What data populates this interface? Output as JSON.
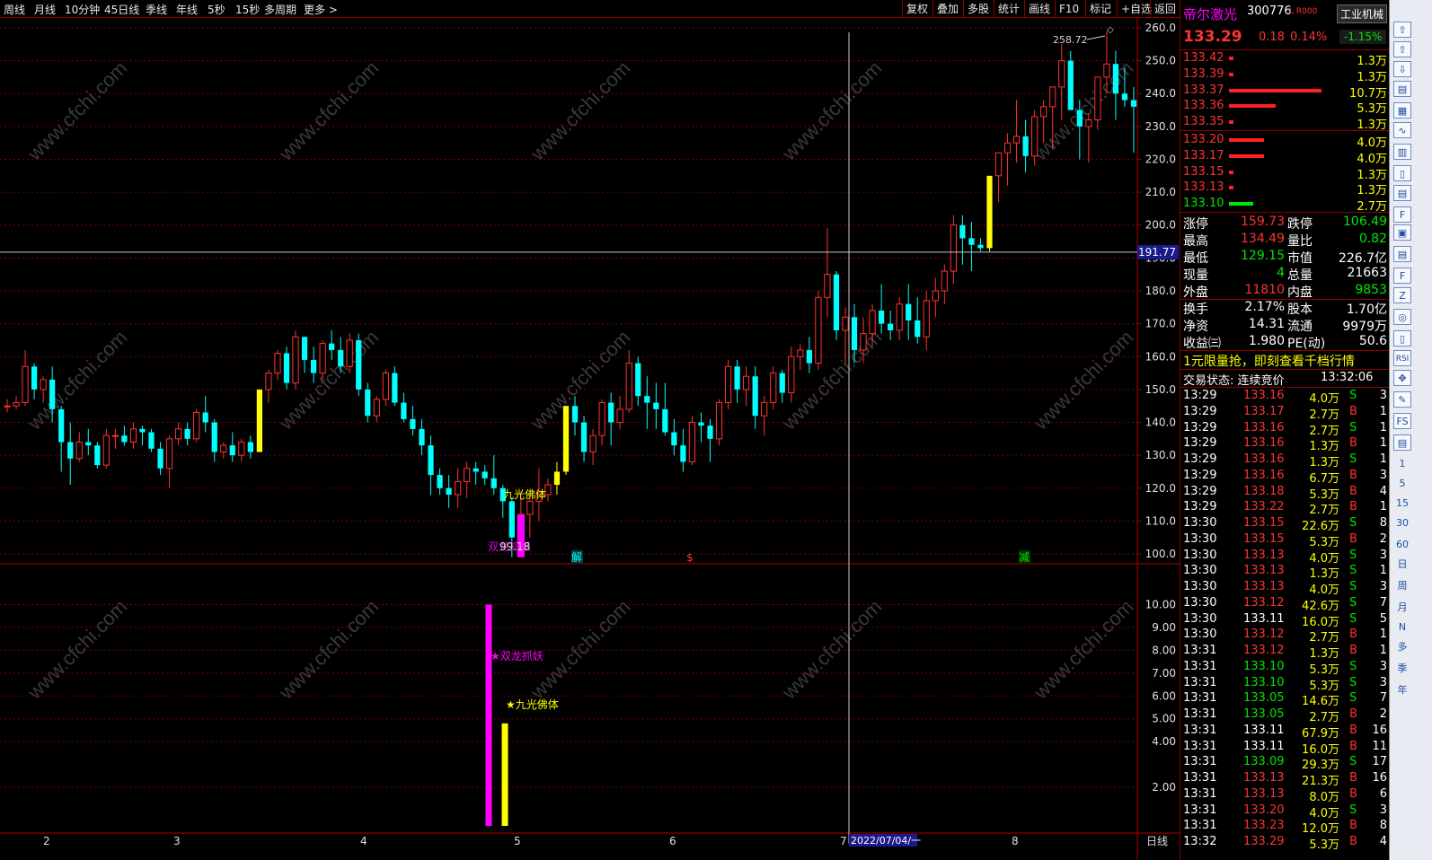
{
  "toolbar": {
    "left_items": [
      "周线",
      "月线",
      "10分钟",
      "45日线",
      "季线",
      "年线",
      "5秒",
      "15秒",
      "多周期",
      "更多 >"
    ],
    "right_items": [
      "复权",
      "叠加",
      "多股",
      "统计",
      "画线",
      "F10",
      "标记",
      "+自选",
      "返回"
    ]
  },
  "watermark": "www.cfchi.com",
  "main_chart": {
    "y_ticks": [
      "260.0",
      "250.0",
      "240.0",
      "230.0",
      "220.0",
      "210.0",
      "200.0",
      "190.0",
      "180.0",
      "170.0",
      "160.0",
      "150.0",
      "140.0",
      "130.0",
      "120.0",
      "110.0",
      "100.0"
    ],
    "y_range": [
      97,
      263
    ],
    "crosshair_price_label": "191.77",
    "crosshair_price": 191.77,
    "high_label": "258.72",
    "low_label": "99.18",
    "annotation_label": "九光佛体",
    "markers": [
      "解",
      "$",
      "减"
    ],
    "bottom_signal_label": "双龙抓妖"
  },
  "sub_chart": {
    "y_ticks": [
      "10.00",
      "9.00",
      "8.00",
      "7.00",
      "6.00",
      "5.00",
      "4.00",
      "2.00"
    ],
    "y_range": [
      0,
      11
    ],
    "bars": [
      {
        "label": "双龙抓妖",
        "value": 10,
        "color": "#ff00ff"
      },
      {
        "label": "九光佛体",
        "value": 4.8,
        "color": "#ffff00"
      }
    ]
  },
  "x_axis": {
    "labels": [
      "2",
      "3",
      "4",
      "5",
      "6",
      "7",
      "8"
    ],
    "date_label": "2022/07/04/一",
    "period_label": "日线"
  },
  "stock": {
    "name": "帝尔激光",
    "code": "300776",
    "flags": "L R000",
    "industry": "工业机械",
    "price": "133.29",
    "change": "0.18",
    "change_pct": "0.14%",
    "industry_pct": "-1.15%"
  },
  "order_book": {
    "asks": [
      {
        "price": "133.42",
        "vol": "1.3万",
        "bar": 0.05
      },
      {
        "price": "133.39",
        "vol": "1.3万",
        "bar": 0.05
      },
      {
        "price": "133.37",
        "vol": "10.7万",
        "bar": 0.95
      },
      {
        "price": "133.36",
        "vol": "5.3万",
        "bar": 0.48
      },
      {
        "price": "133.35",
        "vol": "1.3万",
        "bar": 0.05
      }
    ],
    "bids": [
      {
        "price": "133.20",
        "vol": "4.0万",
        "bar": 0.36
      },
      {
        "price": "133.17",
        "vol": "4.0万",
        "bar": 0.36
      },
      {
        "price": "133.15",
        "vol": "1.3万",
        "bar": 0.05
      },
      {
        "price": "133.13",
        "vol": "1.3万",
        "bar": 0.05
      },
      {
        "price": "133.10",
        "vol": "2.7万",
        "bar": 0.25
      }
    ]
  },
  "stats": [
    {
      "l1": "涨停",
      "v1": "159.73",
      "c1": "red",
      "l2": "跌停",
      "v2": "106.49",
      "c2": "green"
    },
    {
      "l1": "最高",
      "v1": "134.49",
      "c1": "red",
      "l2": "量比",
      "v2": "0.82",
      "c2": "green"
    },
    {
      "l1": "最低",
      "v1": "129.15",
      "c1": "green",
      "l2": "市值",
      "v2": "226.7亿",
      "c2": "white"
    },
    {
      "l1": "现量",
      "v1": "4",
      "c1": "green",
      "l2": "总量",
      "v2": "21663",
      "c2": "white"
    },
    {
      "l1": "外盘",
      "v1": "11810",
      "c1": "red",
      "l2": "内盘",
      "v2": "9853",
      "c2": "green"
    },
    {
      "l1": "换手",
      "v1": "2.17%",
      "c1": "white",
      "l2": "股本",
      "v2": "1.70亿",
      "c2": "white"
    },
    {
      "l1": "净资",
      "v1": "14.31",
      "c1": "white",
      "l2": "流通",
      "v2": "9979万",
      "c2": "white"
    },
    {
      "l1": "收益㈢",
      "v1": "1.980",
      "c1": "white",
      "l2": "PE(动)",
      "v2": "50.6",
      "c2": "white"
    }
  ],
  "promo": "1元限量抢，即刻查看千档行情",
  "trade_status": {
    "label": "交易状态: 连续竞价",
    "time": "13:32:06"
  },
  "ticks": [
    {
      "t": "13:29",
      "p": "133.16",
      "pc": "red",
      "v": "4.0万",
      "bs": "S",
      "n": "3"
    },
    {
      "t": "13:29",
      "p": "133.17",
      "pc": "red",
      "v": "2.7万",
      "bs": "B",
      "n": "1"
    },
    {
      "t": "13:29",
      "p": "133.16",
      "pc": "red",
      "v": "2.7万",
      "bs": "S",
      "n": "1"
    },
    {
      "t": "13:29",
      "p": "133.16",
      "pc": "red",
      "v": "1.3万",
      "bs": "B",
      "n": "1"
    },
    {
      "t": "13:29",
      "p": "133.16",
      "pc": "red",
      "v": "1.3万",
      "bs": "S",
      "n": "1"
    },
    {
      "t": "13:29",
      "p": "133.16",
      "pc": "red",
      "v": "6.7万",
      "bs": "B",
      "n": "3"
    },
    {
      "t": "13:29",
      "p": "133.18",
      "pc": "red",
      "v": "5.3万",
      "bs": "B",
      "n": "4"
    },
    {
      "t": "13:29",
      "p": "133.22",
      "pc": "red",
      "v": "2.7万",
      "bs": "B",
      "n": "1"
    },
    {
      "t": "13:30",
      "p": "133.15",
      "pc": "red",
      "v": "22.6万",
      "bs": "S",
      "n": "8"
    },
    {
      "t": "13:30",
      "p": "133.15",
      "pc": "red",
      "v": "5.3万",
      "bs": "B",
      "n": "2"
    },
    {
      "t": "13:30",
      "p": "133.13",
      "pc": "red",
      "v": "4.0万",
      "bs": "S",
      "n": "3"
    },
    {
      "t": "13:30",
      "p": "133.13",
      "pc": "red",
      "v": "1.3万",
      "bs": "S",
      "n": "1"
    },
    {
      "t": "13:30",
      "p": "133.13",
      "pc": "red",
      "v": "4.0万",
      "bs": "S",
      "n": "3"
    },
    {
      "t": "13:30",
      "p": "133.12",
      "pc": "red",
      "v": "42.6万",
      "bs": "S",
      "n": "7"
    },
    {
      "t": "13:30",
      "p": "133.11",
      "pc": "white",
      "v": "16.0万",
      "bs": "S",
      "n": "5"
    },
    {
      "t": "13:30",
      "p": "133.12",
      "pc": "red",
      "v": "2.7万",
      "bs": "B",
      "n": "1"
    },
    {
      "t": "13:31",
      "p": "133.12",
      "pc": "red",
      "v": "1.3万",
      "bs": "B",
      "n": "1"
    },
    {
      "t": "13:31",
      "p": "133.10",
      "pc": "green",
      "v": "5.3万",
      "bs": "S",
      "n": "3"
    },
    {
      "t": "13:31",
      "p": "133.10",
      "pc": "green",
      "v": "5.3万",
      "bs": "S",
      "n": "3"
    },
    {
      "t": "13:31",
      "p": "133.05",
      "pc": "green",
      "v": "14.6万",
      "bs": "S",
      "n": "7"
    },
    {
      "t": "13:31",
      "p": "133.05",
      "pc": "green",
      "v": "2.7万",
      "bs": "B",
      "n": "2"
    },
    {
      "t": "13:31",
      "p": "133.11",
      "pc": "white",
      "v": "67.9万",
      "bs": "B",
      "n": "16"
    },
    {
      "t": "13:31",
      "p": "133.11",
      "pc": "white",
      "v": "16.0万",
      "bs": "B",
      "n": "11"
    },
    {
      "t": "13:31",
      "p": "133.09",
      "pc": "green",
      "v": "29.3万",
      "bs": "S",
      "n": "17"
    },
    {
      "t": "13:31",
      "p": "133.13",
      "pc": "red",
      "v": "21.3万",
      "bs": "B",
      "n": "16"
    },
    {
      "t": "13:31",
      "p": "133.13",
      "pc": "red",
      "v": "8.0万",
      "bs": "B",
      "n": "6"
    },
    {
      "t": "13:31",
      "p": "133.20",
      "pc": "red",
      "v": "4.0万",
      "bs": "S",
      "n": "3"
    },
    {
      "t": "13:31",
      "p": "133.23",
      "pc": "red",
      "v": "12.0万",
      "bs": "B",
      "n": "8"
    },
    {
      "t": "13:32",
      "p": "133.29",
      "pc": "red",
      "v": "5.3万",
      "bs": "B",
      "n": "4"
    }
  ],
  "side_icons": [
    "⇧",
    "⇧",
    "⇩",
    "▤",
    "▦",
    "∿",
    "▥",
    "▯",
    "▤",
    "F",
    "▣",
    "▤",
    "F",
    "Z",
    "◎",
    "▯",
    "RSI",
    "✥",
    "✎",
    "FS",
    "▤",
    "1",
    "5",
    "15",
    "30",
    "60",
    "日",
    "周",
    "月",
    "N",
    "多",
    "季",
    "年"
  ],
  "colors": {
    "up": "#ff3232",
    "down": "#00ffff",
    "grid": "#8b0000",
    "signal_magenta": "#ff00ff",
    "signal_yellow": "#ffff00"
  },
  "chart_data": {
    "type": "candlestick",
    "ohlc": [
      [
        145,
        147,
        143,
        145
      ],
      [
        145,
        148,
        144,
        146
      ],
      [
        146,
        162,
        145,
        157
      ],
      [
        157,
        158,
        147,
        150
      ],
      [
        150,
        154,
        146,
        153
      ],
      [
        153,
        157,
        140,
        144
      ],
      [
        144,
        145,
        125,
        134
      ],
      [
        134,
        140,
        121,
        129
      ],
      [
        129,
        137,
        128,
        134
      ],
      [
        134,
        138,
        130,
        133
      ],
      [
        133,
        134,
        126,
        127
      ],
      [
        127,
        138,
        126,
        136
      ],
      [
        136,
        138,
        132,
        136
      ],
      [
        136,
        139,
        133,
        134
      ],
      [
        134,
        140,
        132,
        138
      ],
      [
        138,
        139,
        133,
        137
      ],
      [
        137,
        138,
        131,
        132
      ],
      [
        132,
        134,
        124,
        126
      ],
      [
        126,
        136,
        120,
        135
      ],
      [
        135,
        140,
        133,
        138
      ],
      [
        138,
        140,
        133,
        135
      ],
      [
        135,
        144,
        134,
        143
      ],
      [
        143,
        148,
        137,
        140
      ],
      [
        140,
        141,
        128,
        131
      ],
      [
        131,
        134,
        129,
        133
      ],
      [
        133,
        137,
        128,
        130
      ],
      [
        130,
        135,
        128,
        134
      ],
      [
        134,
        136,
        129,
        131
      ],
      [
        131,
        150,
        131,
        150
      ],
      [
        150,
        156,
        146,
        155
      ],
      [
        155,
        162,
        153,
        161
      ],
      [
        161,
        163,
        150,
        152
      ],
      [
        152,
        168,
        150,
        166
      ],
      [
        166,
        166,
        155,
        159
      ],
      [
        159,
        163,
        152,
        155
      ],
      [
        155,
        165,
        153,
        164
      ],
      [
        164,
        168,
        159,
        162
      ],
      [
        162,
        166,
        155,
        157
      ],
      [
        157,
        167,
        155,
        165
      ],
      [
        165,
        167,
        148,
        150
      ],
      [
        150,
        152,
        140,
        142
      ],
      [
        142,
        148,
        140,
        147
      ],
      [
        147,
        156,
        145,
        155
      ],
      [
        155,
        157,
        145,
        146
      ],
      [
        146,
        149,
        140,
        141
      ],
      [
        141,
        145,
        136,
        138
      ],
      [
        138,
        141,
        130,
        133
      ],
      [
        133,
        136,
        118,
        124
      ],
      [
        124,
        126,
        118,
        120
      ],
      [
        120,
        124,
        114,
        118
      ],
      [
        118,
        126,
        114,
        122
      ],
      [
        122,
        128,
        117,
        126
      ],
      [
        126,
        128,
        121,
        125
      ],
      [
        125,
        127,
        121,
        123
      ],
      [
        123,
        130,
        118,
        120
      ],
      [
        120,
        121,
        111,
        116
      ],
      [
        116,
        117,
        99,
        105
      ],
      [
        105,
        119,
        99,
        112
      ],
      [
        112,
        118,
        105,
        116
      ],
      [
        116,
        126,
        110,
        118
      ],
      [
        118,
        123,
        116,
        121
      ],
      [
        121,
        128,
        118,
        125
      ],
      [
        125,
        145,
        124,
        145
      ],
      [
        145,
        148,
        136,
        140
      ],
      [
        140,
        142,
        128,
        131
      ],
      [
        131,
        138,
        127,
        136
      ],
      [
        136,
        147,
        133,
        146
      ],
      [
        146,
        149,
        133,
        140
      ],
      [
        140,
        148,
        138,
        144
      ],
      [
        144,
        162,
        143,
        158
      ],
      [
        158,
        160,
        145,
        148
      ],
      [
        148,
        154,
        138,
        146
      ],
      [
        146,
        152,
        138,
        144
      ],
      [
        144,
        152,
        136,
        137
      ],
      [
        137,
        141,
        130,
        133
      ],
      [
        133,
        138,
        125,
        128
      ],
      [
        128,
        142,
        127,
        140
      ],
      [
        140,
        143,
        134,
        139
      ],
      [
        139,
        141,
        128,
        135
      ],
      [
        135,
        147,
        133,
        146
      ],
      [
        146,
        159,
        144,
        157
      ],
      [
        157,
        159,
        146,
        150
      ],
      [
        150,
        157,
        145,
        154
      ],
      [
        154,
        157,
        138,
        142
      ],
      [
        142,
        148,
        136,
        146
      ],
      [
        146,
        157,
        144,
        155
      ],
      [
        155,
        156,
        146,
        149
      ],
      [
        149,
        163,
        146,
        160
      ],
      [
        160,
        164,
        156,
        162
      ],
      [
        162,
        166,
        155,
        158
      ],
      [
        158,
        180,
        156,
        178
      ],
      [
        178,
        199,
        172,
        185
      ],
      [
        185,
        186,
        165,
        168
      ],
      [
        168,
        175,
        158,
        172
      ],
      [
        172,
        176,
        158,
        162
      ],
      [
        162,
        172,
        158,
        167
      ],
      [
        167,
        176,
        163,
        174
      ],
      [
        174,
        182,
        167,
        170
      ],
      [
        170,
        174,
        165,
        168
      ],
      [
        168,
        178,
        165,
        176
      ],
      [
        176,
        182,
        165,
        171
      ],
      [
        171,
        178,
        164,
        166
      ],
      [
        166,
        180,
        162,
        177
      ],
      [
        177,
        184,
        172,
        180
      ],
      [
        180,
        188,
        176,
        186
      ],
      [
        186,
        203,
        182,
        200
      ],
      [
        200,
        203,
        188,
        196
      ],
      [
        196,
        201,
        186,
        194
      ],
      [
        194,
        196,
        192,
        193
      ],
      [
        193,
        214,
        192,
        215
      ],
      [
        215,
        221,
        207,
        222
      ],
      [
        222,
        228,
        212,
        225
      ],
      [
        225,
        238,
        219,
        227
      ],
      [
        227,
        232,
        216,
        221
      ],
      [
        221,
        235,
        218,
        233
      ],
      [
        233,
        238,
        225,
        236
      ],
      [
        236,
        241,
        223,
        242
      ],
      [
        242,
        255,
        232,
        250
      ],
      [
        250,
        253,
        237,
        235
      ],
      [
        235,
        238,
        220,
        230
      ],
      [
        230,
        234,
        219,
        232
      ],
      [
        232,
        245,
        229,
        245
      ],
      [
        245,
        259,
        240,
        249
      ],
      [
        249,
        253,
        232,
        240
      ],
      [
        240,
        248,
        236,
        238
      ],
      [
        238,
        242,
        222,
        236
      ]
    ],
    "series": [
      {
        "name": "双龙抓妖",
        "values": [
          10
        ]
      },
      {
        "name": "九光佛体",
        "values": [
          4.8
        ]
      }
    ],
    "ylim": [
      97,
      263
    ]
  }
}
